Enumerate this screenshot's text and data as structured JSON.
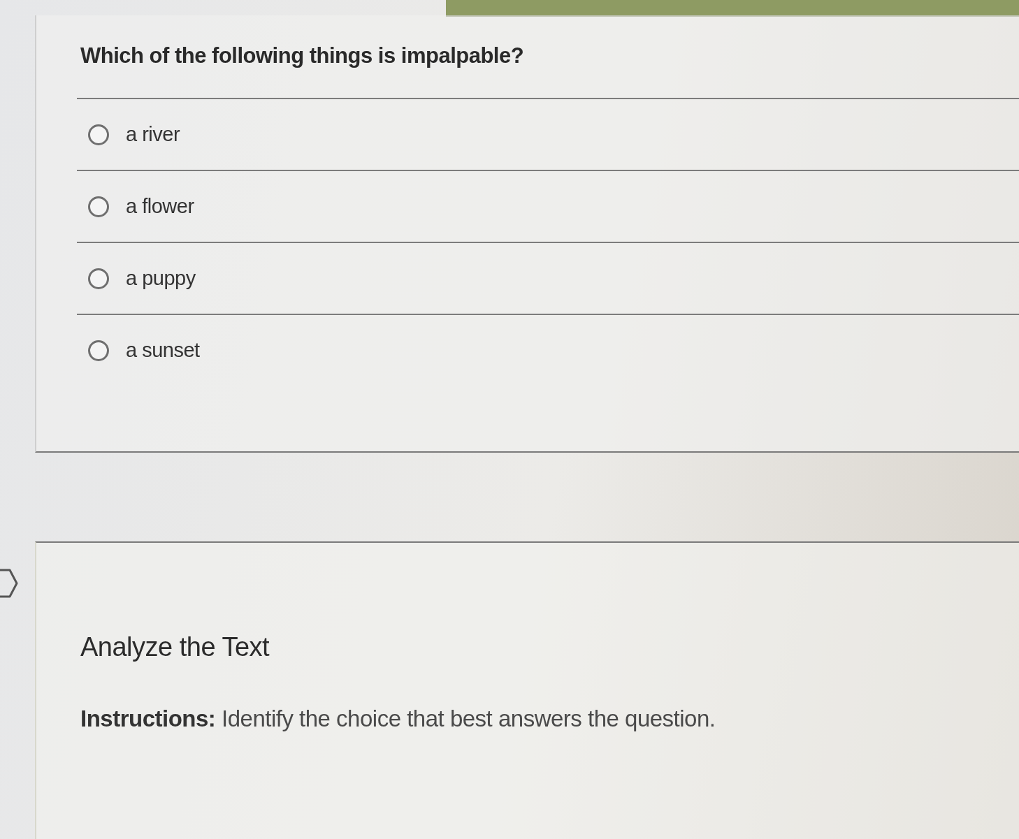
{
  "question": {
    "text": "Which of the following things is impalpable?",
    "options": [
      {
        "label": "a river",
        "selected": false
      },
      {
        "label": "a flower",
        "selected": false
      },
      {
        "label": "a puppy",
        "selected": false
      },
      {
        "label": "a sunset",
        "selected": false
      }
    ]
  },
  "section": {
    "title": "Analyze the Text",
    "instructions": "**Instructions:** Identify the choice that best answers the question."
  }
}
